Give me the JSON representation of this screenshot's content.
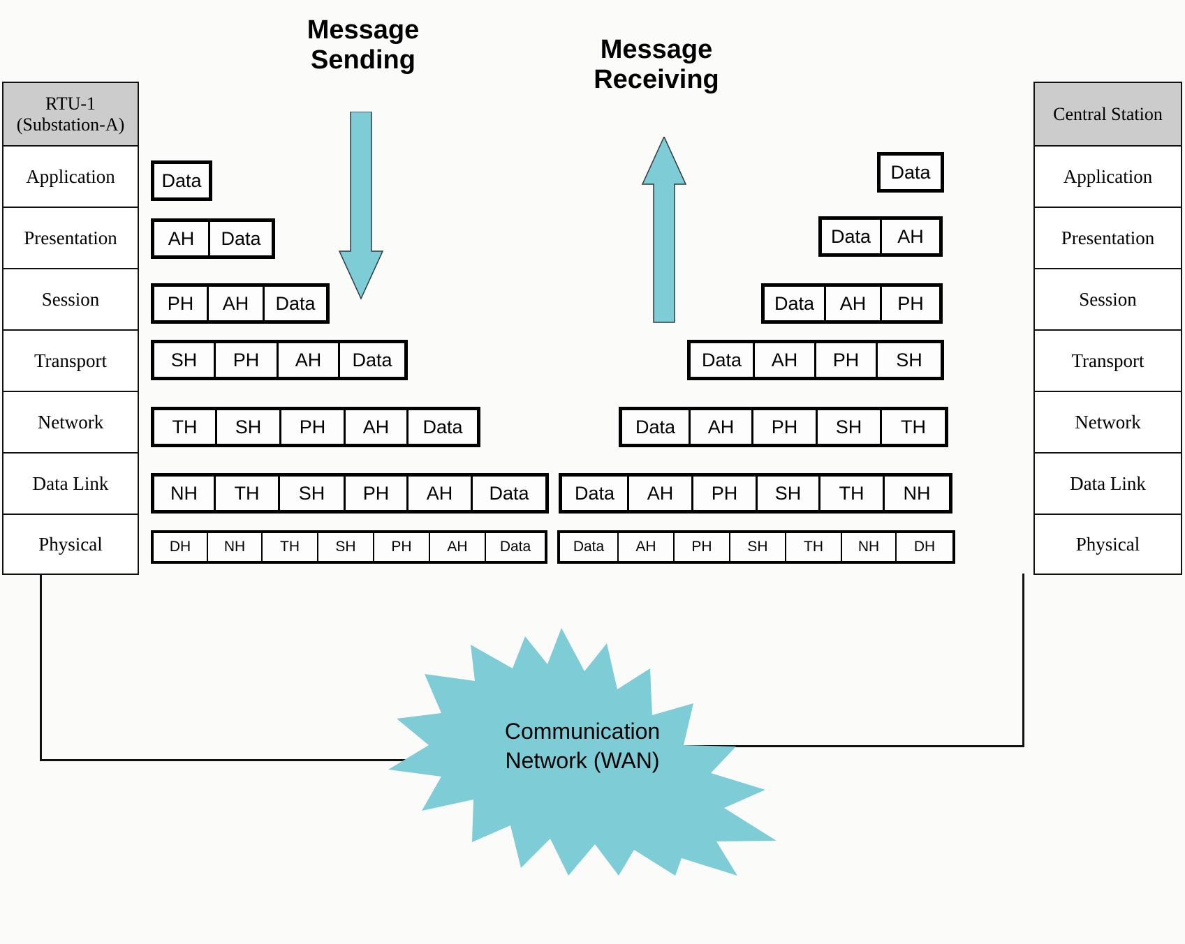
{
  "titles": {
    "sending": "Message\nSending",
    "receiving": "Message\nReceiving"
  },
  "left_stack": {
    "header": "RTU-1\n(Substation-A)",
    "layers": [
      "Application",
      "Presentation",
      "Session",
      "Transport",
      "Network",
      "Data Link",
      "Physical"
    ]
  },
  "right_stack": {
    "header": "Central Station",
    "layers": [
      "Application",
      "Presentation",
      "Session",
      "Transport",
      "Network",
      "Data Link",
      "Physical"
    ]
  },
  "sending_pdus": [
    {
      "layer": "Application",
      "cells": [
        "Data"
      ]
    },
    {
      "layer": "Presentation",
      "cells": [
        "AH",
        "Data"
      ]
    },
    {
      "layer": "Session",
      "cells": [
        "PH",
        "AH",
        "Data"
      ]
    },
    {
      "layer": "Transport",
      "cells": [
        "SH",
        "PH",
        "AH",
        "Data"
      ]
    },
    {
      "layer": "Network",
      "cells": [
        "TH",
        "SH",
        "PH",
        "AH",
        "Data"
      ]
    },
    {
      "layer": "Data Link",
      "cells": [
        "NH",
        "TH",
        "SH",
        "PH",
        "AH",
        "Data"
      ]
    },
    {
      "layer": "Physical",
      "cells": [
        "DH",
        "NH",
        "TH",
        "SH",
        "PH",
        "AH",
        "Data"
      ]
    }
  ],
  "receiving_pdus": [
    {
      "layer": "Application",
      "cells": [
        "Data"
      ]
    },
    {
      "layer": "Presentation",
      "cells": [
        "Data",
        "AH"
      ]
    },
    {
      "layer": "Session",
      "cells": [
        "Data",
        "AH",
        "PH"
      ]
    },
    {
      "layer": "Transport",
      "cells": [
        "Data",
        "AH",
        "PH",
        "SH"
      ]
    },
    {
      "layer": "Network",
      "cells": [
        "Data",
        "AH",
        "PH",
        "SH",
        "TH"
      ]
    },
    {
      "layer": "Data Link",
      "cells": [
        "Data",
        "AH",
        "PH",
        "SH",
        "TH",
        "NH"
      ]
    },
    {
      "layer": "Physical",
      "cells": [
        "Data",
        "AH",
        "PH",
        "SH",
        "TH",
        "NH",
        "DH"
      ]
    }
  ],
  "network": {
    "label": "Communication\nNetwork (WAN)"
  },
  "colors": {
    "accent_teal": "#7ecdd6",
    "header_gray": "#cccccc",
    "outline": "#111111",
    "background": "#fbfbfa"
  },
  "icons": {
    "down_arrow": "down-arrow-icon",
    "up_arrow": "up-arrow-icon",
    "starburst": "starburst-icon"
  }
}
